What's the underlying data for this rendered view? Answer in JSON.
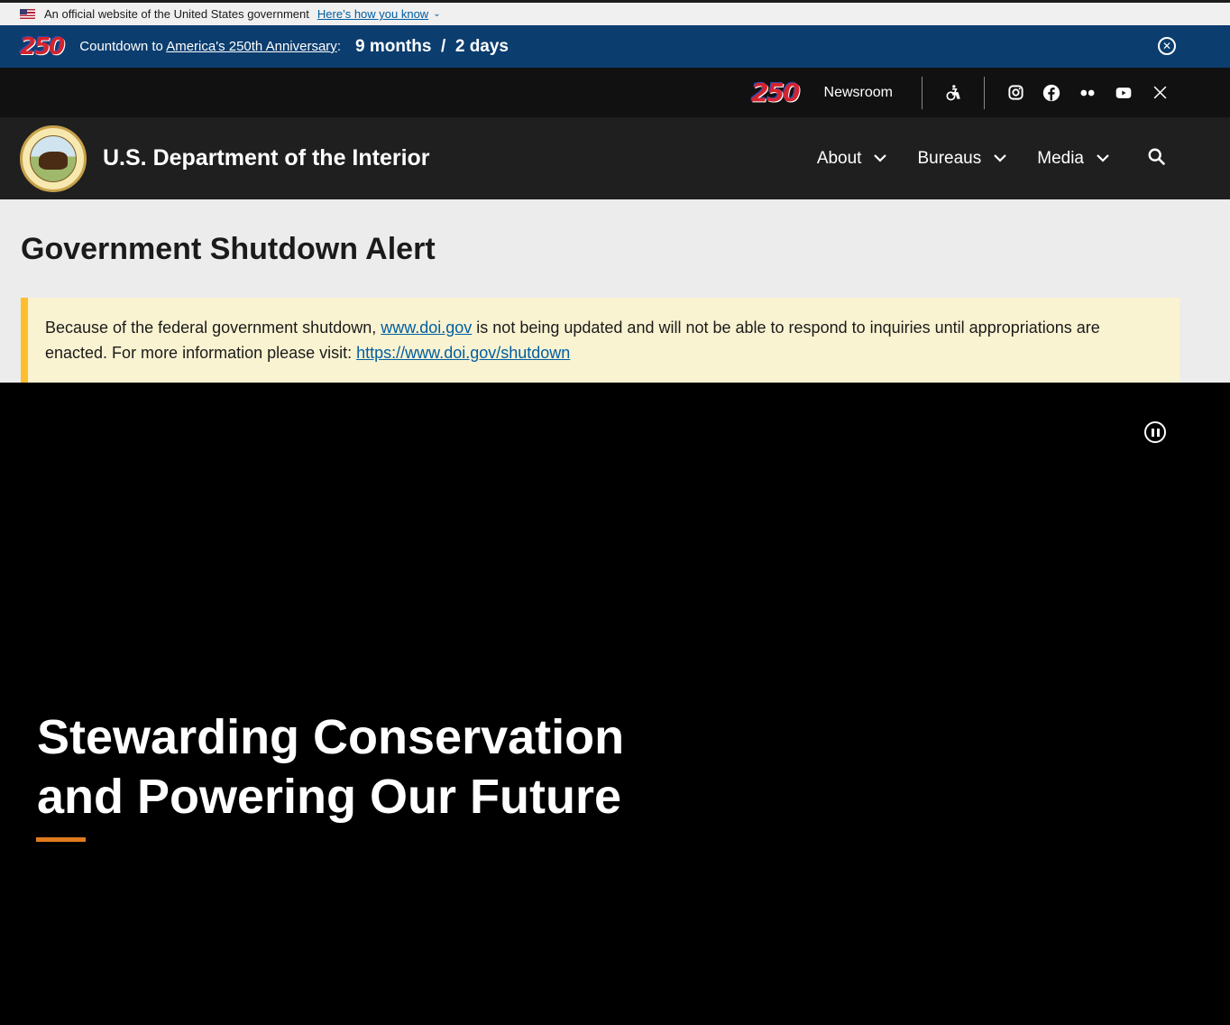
{
  "gov_banner": {
    "official_text": "An official website of the United States government",
    "how_link": "Here’s how you know",
    "chevron_icon": "chevron-down-icon"
  },
  "countdown": {
    "logo_text": "250",
    "label_prefix": "Countdown to ",
    "label_link": "America's 250th Anniversary",
    "label_suffix": ":",
    "months": "9 months",
    "separator": "/",
    "days": "2 days",
    "close_icon": "close-circle-icon"
  },
  "utility": {
    "logo_text": "250",
    "newsroom": "Newsroom",
    "icons": [
      "accessibility-icon",
      "instagram-icon",
      "facebook-icon",
      "flickr-icon",
      "youtube-icon",
      "x-icon"
    ]
  },
  "header": {
    "site_title": "U.S. Department of the Interior",
    "nav": [
      {
        "label": "About"
      },
      {
        "label": "Bureaus"
      },
      {
        "label": "Media"
      }
    ],
    "search_icon": "search-icon"
  },
  "alert": {
    "title": "Government Shutdown Alert",
    "text_before_link": "Because of the federal government shutdown, ",
    "link1": "www.doi.gov",
    "text_after_link": " is not being updated and will not be able to respond to inquiries until appropriations are enacted. For more information please visit: ",
    "link2": "https://www.doi.gov/shutdown"
  },
  "hero": {
    "title_line1": "Stewarding Conservation",
    "title_line2": "and Powering Our Future",
    "pause_icon": "pause-icon"
  },
  "colors": {
    "countdown_bg": "#0b3d6e",
    "header_bg": "#1f1f1f",
    "alert_bg": "#faf3d1",
    "alert_border": "#ffbe2e",
    "hero_rule": "#e07b1f",
    "link": "#005ea2"
  }
}
